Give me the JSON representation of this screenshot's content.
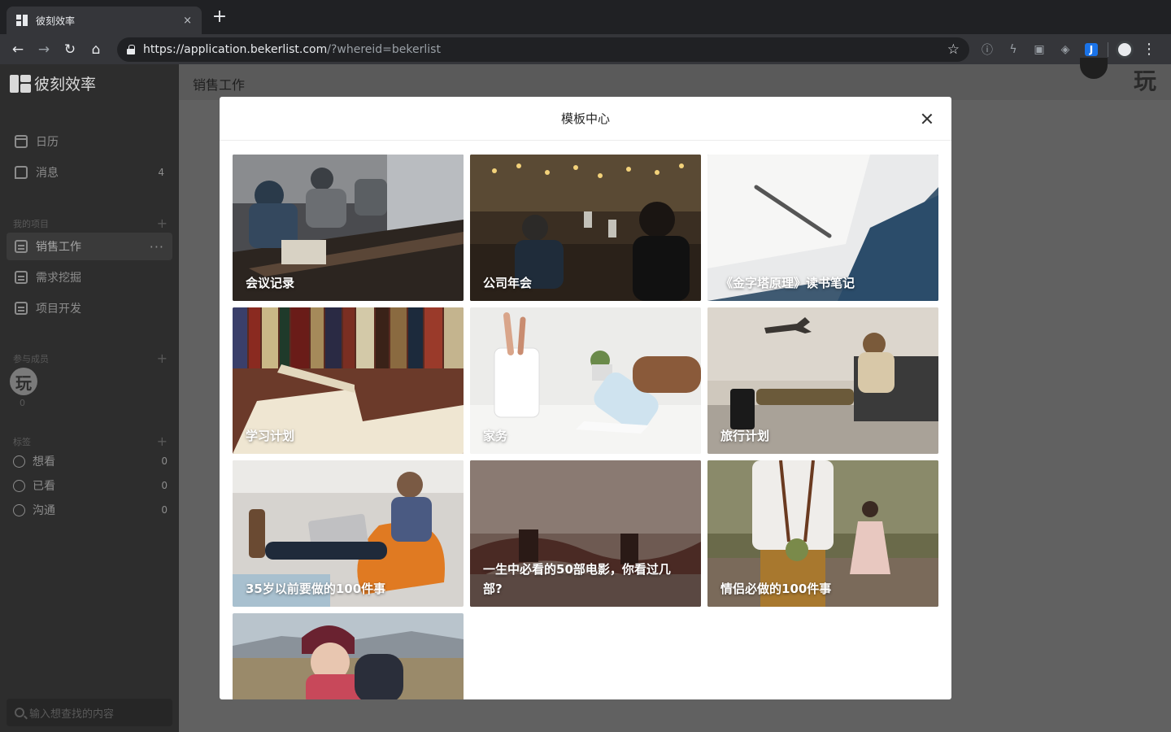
{
  "browser": {
    "tab_title": "彼刻效率",
    "tab_close": "×",
    "new_tab": "+",
    "url_host": "https://application.bekerlist.com",
    "url_rest": "/?whereid=bekerlist",
    "ext_j": "J"
  },
  "sidebar": {
    "logo_text": "彼刻效率",
    "nav": [
      {
        "label": "日历",
        "icon": "calendar-icon"
      },
      {
        "label": "消息",
        "icon": "message-icon",
        "count": "4"
      }
    ],
    "projects_header": "我的项目",
    "projects": [
      {
        "label": "销售工作",
        "active": true,
        "more": "···"
      },
      {
        "label": "需求挖掘"
      },
      {
        "label": "项目开发"
      }
    ],
    "members_header": "参与成员",
    "member_avatar": "玩",
    "member_count": "0",
    "tags_header": "标签",
    "tags": [
      {
        "label": "想看",
        "count": "0"
      },
      {
        "label": "已看",
        "count": "0"
      },
      {
        "label": "沟通",
        "count": "0"
      }
    ],
    "search_placeholder": "输入想查找的内容"
  },
  "main": {
    "title": "销售工作",
    "header_logo": "玩"
  },
  "modal": {
    "title": "模板中心",
    "templates": [
      {
        "label": "会议记录"
      },
      {
        "label": "公司年会"
      },
      {
        "label": "《金字塔原理》读书笔记"
      },
      {
        "label": "学习计划"
      },
      {
        "label": "家务"
      },
      {
        "label": "旅行计划"
      },
      {
        "label": "35岁以前要做的100件事"
      },
      {
        "label": "一生中必看的50部电影，你看过几部?"
      },
      {
        "label": "情侣必做的100件事"
      },
      {
        "label": ""
      }
    ]
  }
}
